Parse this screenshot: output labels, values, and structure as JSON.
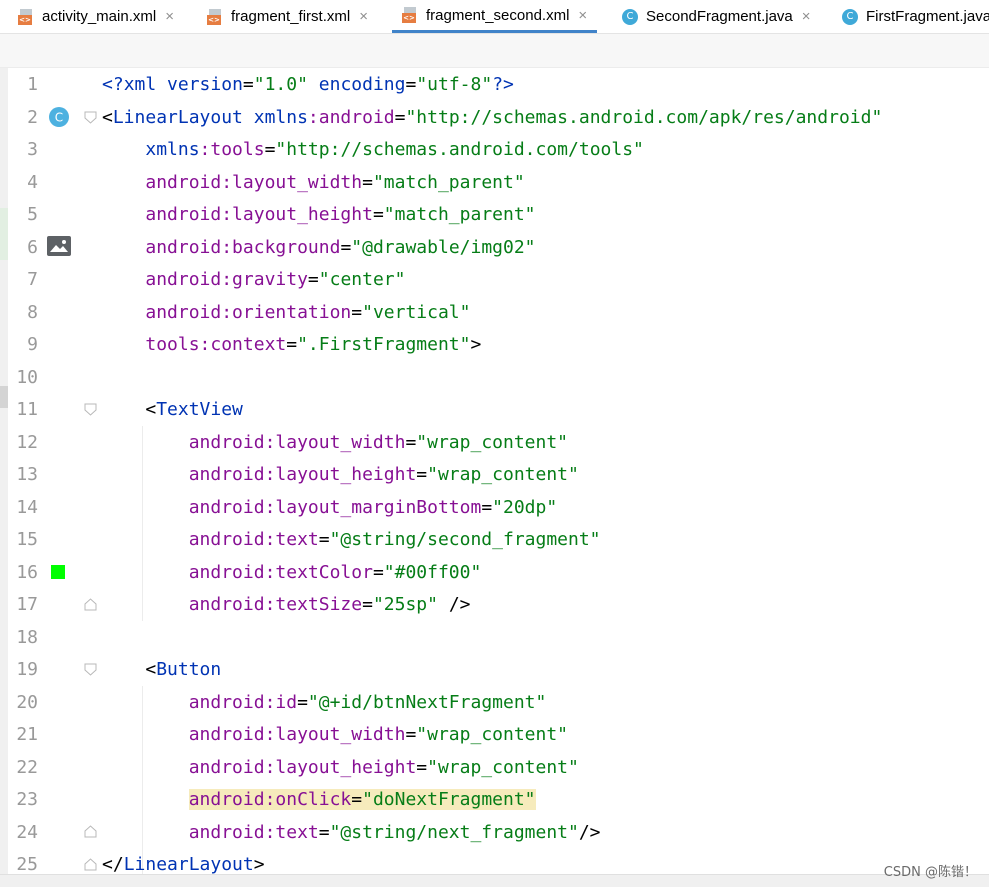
{
  "tabs": [
    {
      "label": "activity_main.xml",
      "type": "xml"
    },
    {
      "label": "fragment_first.xml",
      "type": "xml"
    },
    {
      "label": "fragment_second.xml",
      "type": "xml",
      "active": true
    },
    {
      "label": "SecondFragment.java",
      "type": "class"
    },
    {
      "label": "FirstFragment.java",
      "type": "class"
    }
  ],
  "tab_close_glyph": "×",
  "class_icon_letter": "C",
  "colors": {
    "active_tab_underline": "#4083c9",
    "tag": "#0033b3",
    "attribute": "#871094",
    "value": "#067d17",
    "highlight": "#f6ebbc",
    "color_swatch": "#00ff00"
  },
  "editor": {
    "lines": [
      {
        "n": "1",
        "code": "<?xml version=\"1.0\" encoding=\"utf-8\"?>"
      },
      {
        "n": "2",
        "code": "<LinearLayout xmlns:android=\"http://schemas.android.com/apk/res/android\""
      },
      {
        "n": "3",
        "code": "    xmlns:tools=\"http://schemas.android.com/tools\""
      },
      {
        "n": "4",
        "code": "    android:layout_width=\"match_parent\""
      },
      {
        "n": "5",
        "code": "    android:layout_height=\"match_parent\""
      },
      {
        "n": "6",
        "code": "    android:background=\"@drawable/img02\""
      },
      {
        "n": "7",
        "code": "    android:gravity=\"center\""
      },
      {
        "n": "8",
        "code": "    android:orientation=\"vertical\""
      },
      {
        "n": "9",
        "code": "    tools:context=\".FirstFragment\">"
      },
      {
        "n": "10",
        "code": ""
      },
      {
        "n": "11",
        "code": "    <TextView"
      },
      {
        "n": "12",
        "code": "        android:layout_width=\"wrap_content\""
      },
      {
        "n": "13",
        "code": "        android:layout_height=\"wrap_content\""
      },
      {
        "n": "14",
        "code": "        android:layout_marginBottom=\"20dp\""
      },
      {
        "n": "15",
        "code": "        android:text=\"@string/second_fragment\""
      },
      {
        "n": "16",
        "code": "        android:textColor=\"#00ff00\""
      },
      {
        "n": "17",
        "code": "        android:textSize=\"25sp\" />"
      },
      {
        "n": "18",
        "code": ""
      },
      {
        "n": "19",
        "code": "    <Button"
      },
      {
        "n": "20",
        "code": "        android:id=\"@+id/btnNextFragment\""
      },
      {
        "n": "21",
        "code": "        android:layout_width=\"wrap_content\""
      },
      {
        "n": "22",
        "code": "        android:layout_height=\"wrap_content\""
      },
      {
        "n": "23",
        "code": "        android:onClick=\"doNextFragment\"",
        "highlight": true
      },
      {
        "n": "24",
        "code": "        android:text=\"@string/next_fragment\"/>"
      },
      {
        "n": "25",
        "code": "</LinearLayout>"
      }
    ]
  },
  "gutter_icons": {
    "line2": "class-icon",
    "line6": "image-icon",
    "line16": "color-swatch-icon"
  },
  "watermark": "CSDN @陈锴！"
}
